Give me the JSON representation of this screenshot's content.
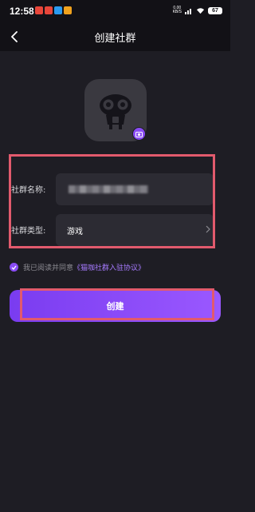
{
  "status_bar": {
    "time": "12:58",
    "net_speed_value": "0.00",
    "net_speed_unit": "KB/S",
    "battery": "67"
  },
  "nav": {
    "title": "创建社群"
  },
  "form": {
    "name_label": "社群名称:",
    "type_label": "社群类型:",
    "type_value": "游戏"
  },
  "agreement": {
    "text": "我已阅读并同意",
    "link": "《猫咖社群入驻协议》"
  },
  "create_button_label": "创建",
  "colors": {
    "accent": "#8a4cf5",
    "background": "#1e1d24",
    "field": "#2c2b33",
    "highlight": "#e25a6d"
  },
  "icons": {
    "back": "chevron-left-icon",
    "avatar": "owl-mascot-icon",
    "camera": "camera-icon",
    "chevron": "chevron-right-icon",
    "check": "check-icon"
  }
}
